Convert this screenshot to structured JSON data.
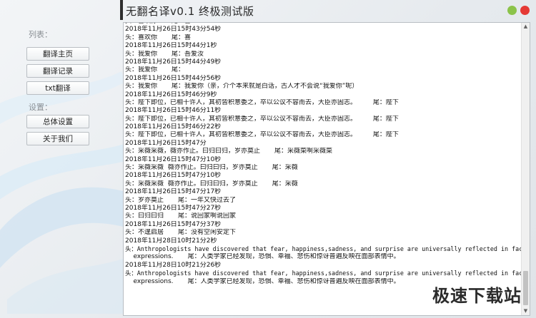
{
  "window": {
    "title": "无翻名译v0.1   终极测试版",
    "dot_colors": {
      "green": "#8bc34a",
      "red": "#e53935"
    }
  },
  "sidebar": {
    "list_label": "列表：",
    "settings_label": "设置：",
    "nav_items": [
      {
        "label": "翻译主页"
      },
      {
        "label": "翻译记录"
      },
      {
        "label": "txt翻译"
      }
    ],
    "setting_items": [
      {
        "label": "总体设置"
      },
      {
        "label": "关于我们"
      }
    ],
    "highlight_color": "#e0232b"
  },
  "log": {
    "lines": [
      "头：喜欢你       尾：喜",
      "2018年11月26日15时43分54秒",
      "头：喜欢你       尾：喜",
      "2018年11月26日15时44分1秒",
      "头：我爱你       尾：吾爱汝",
      "2018年11月26日15时44分49秒",
      "头：我爱你       尾：",
      "2018年11月26日15时44分56秒",
      "头：我爱你       尾：我爱你（亲，介个本来就是白话，古人才不会说“我爱你”呢）",
      "2018年11月26日15时46分9秒",
      "头：陛下即位，已相十许人，其初皆积意委之，卒以公议不容而去，大臣亦固志。        尾：陛下",
      "2018年11月26日15时46分11秒",
      "头：陛下即位，已相十许人，其初皆积意委之，卒以公议不容而去，大臣亦固志。        尾：陛下",
      "2018年11月26日15时46分22秒",
      "头：陛下即位，已相十许人，其初皆积意委之，卒以公议不容而去，大臣亦固志。        尾：陛下",
      "2018年11月26日15时47分",
      "头：采薇采薇，薇亦作止。曰归曰归，岁亦莫止       尾：采薇菜啊采薇菜",
      "2018年11月26日15时47分10秒",
      "头：采薇采薇  薇亦作止。曰归曰归，岁亦莫止       尾：采薇",
      "2018年11月26日15时47分10秒",
      "头：采薇采薇  薇亦作止。曰归曰归，岁亦莫止       尾：采薇",
      "2018年11月26日15时47分17秒",
      "头：岁亦莫止       尾：一年又快过去了",
      "2018年11月26日15时47分27秒",
      "头：曰归曰归       尾：说回家啊说回家",
      "2018年11月26日15时47分37秒",
      "头：不遑启居       尾：没有空闲安定下",
      "2018年11月28日10时21分2秒",
      "头：Anthropologists have discovered that fear, happiness,sadness, and surprise are universally reflected in facial",
      "    expressions.       尾：人类学家已经发现，恐惧、幸福、悲伤和惊讶普遍反映在面部表情中。",
      "2018年11月28日10时21分26秒",
      "头：Anthropologists have discovered that fear, happiness,sadness, and surprise are universally reflected in facial",
      "    expressions.       尾：人类学家已经发现，恐惧、幸福、悲伤和惊讶普遍反映在面部表情中。"
    ]
  },
  "scrollbar": {
    "up_icon": "▲",
    "down_icon": "▼"
  },
  "watermark": "极速下载站"
}
